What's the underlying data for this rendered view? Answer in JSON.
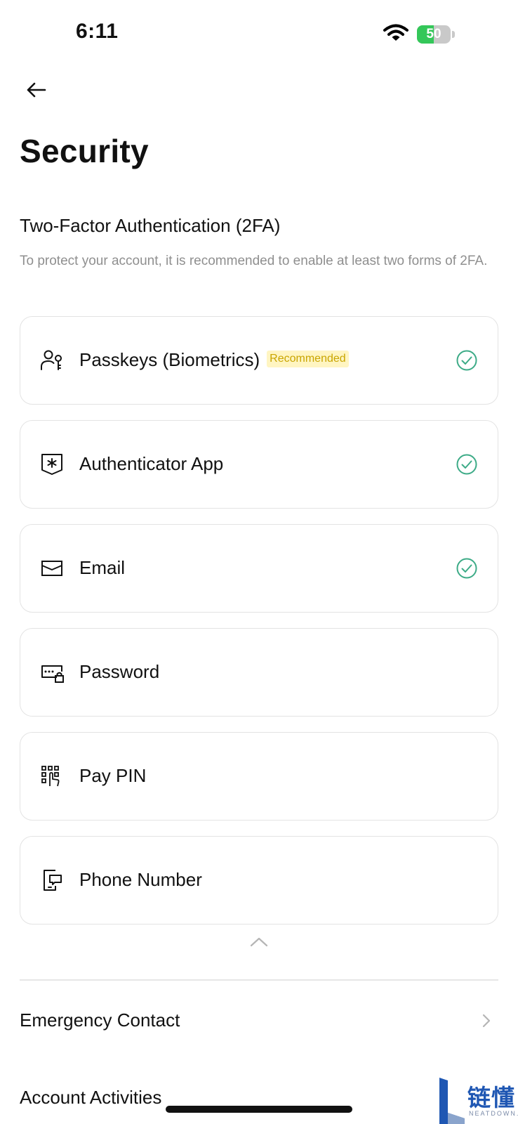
{
  "status_bar": {
    "time": "6:11",
    "battery_level": "50",
    "battery_fraction": 0.5
  },
  "header": {
    "title": "Security"
  },
  "two_fa": {
    "title": "Two-Factor Authentication (2FA)",
    "description": "To protect your account, it is recommended to enable at least two forms of 2FA.",
    "methods": [
      {
        "label": "Passkeys (Biometrics)",
        "badge": "Recommended",
        "icon": "passkey-user-key-icon",
        "enabled": true
      },
      {
        "label": "Authenticator App",
        "icon": "authenticator-shield-icon",
        "enabled": true
      },
      {
        "label": "Email",
        "icon": "envelope-icon",
        "enabled": true
      },
      {
        "label": "Password",
        "icon": "password-lock-icon",
        "enabled": false
      },
      {
        "label": "Pay PIN",
        "icon": "keypad-icon",
        "enabled": false
      },
      {
        "label": "Phone Number",
        "icon": "phone-message-icon",
        "enabled": false
      }
    ]
  },
  "settings_links": [
    {
      "label": "Emergency Contact"
    },
    {
      "label": "Account Activities"
    }
  ],
  "watermark": {
    "cn": "链懂",
    "en": "NEATDOWN.COM"
  },
  "colors": {
    "check": "#3dab87",
    "badge_text": "#c9a500",
    "badge_bg": "#fff5c2",
    "battery": "#34c759",
    "watermark": "#1f57b3"
  }
}
